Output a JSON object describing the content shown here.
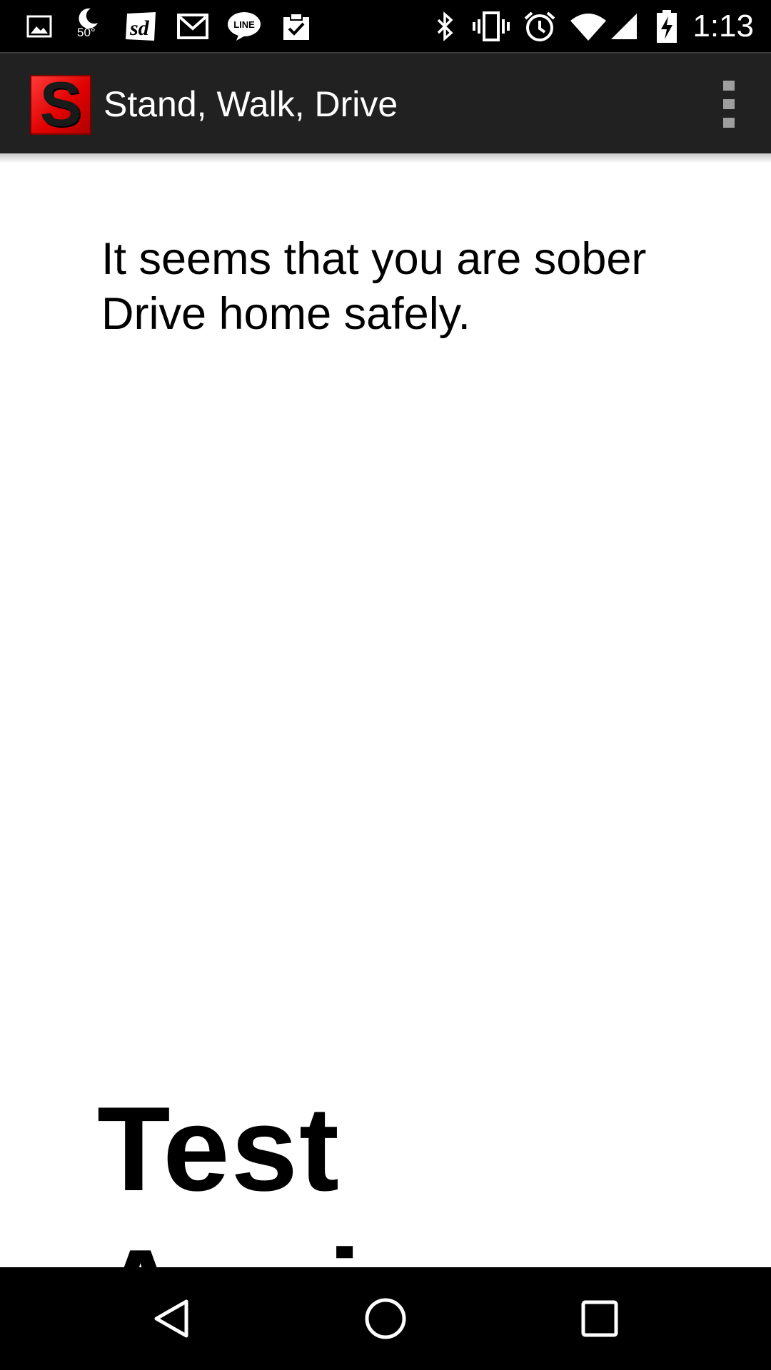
{
  "status_bar": {
    "weather_temp": "50°",
    "time": "1:13",
    "left_icons": [
      "gallery-icon",
      "weather-moon-icon",
      "sd-app-icon",
      "gmail-icon",
      "line-icon",
      "clipboard-check-icon"
    ],
    "right_icons": [
      "bluetooth-icon",
      "vibrate-icon",
      "alarm-icon",
      "wifi-icon",
      "cell-signal-icon",
      "battery-charging-icon"
    ]
  },
  "action_bar": {
    "logo_letter": "S",
    "title": "Stand, Walk, Drive",
    "menu_icon": "overflow-menu-icon"
  },
  "content": {
    "message": "It seems that you are sober\nDrive home safely.",
    "test_again_label": "Test Again"
  },
  "nav_bar": {
    "buttons": [
      "back-icon",
      "home-icon",
      "recents-icon"
    ]
  },
  "colors": {
    "status_bar": "#000000",
    "action_bar": "#212121",
    "logo_red": "#e00000",
    "background": "#ffffff",
    "text": "#000000"
  }
}
